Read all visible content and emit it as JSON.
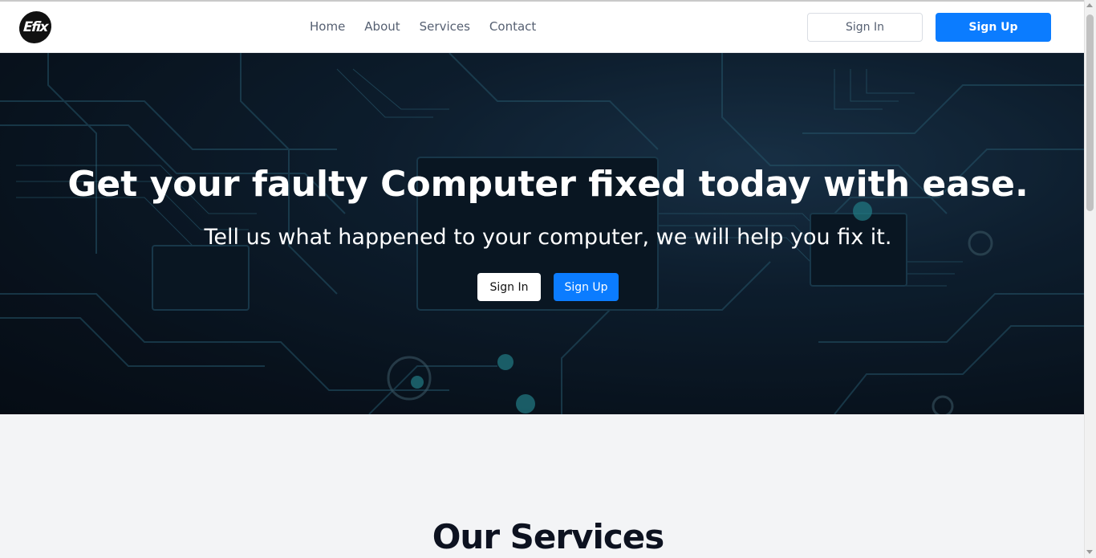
{
  "navbar": {
    "logo_text": "Efix",
    "links": [
      {
        "label": "Home"
      },
      {
        "label": "About"
      },
      {
        "label": "Services"
      },
      {
        "label": "Contact"
      }
    ],
    "signin_label": "Sign In",
    "signup_label": "Sign Up"
  },
  "hero": {
    "title": "Get your faulty Computer fixed today with ease.",
    "subtitle": "Tell us what happened to your computer, we will help you fix it.",
    "signin_label": "Sign In",
    "signup_label": "Sign Up"
  },
  "services": {
    "title": "Our Services"
  },
  "colors": {
    "accent": "#0b7cff",
    "nav_text": "#566072",
    "section_bg": "#f3f4f6",
    "hero_bg": "#0f2233"
  }
}
